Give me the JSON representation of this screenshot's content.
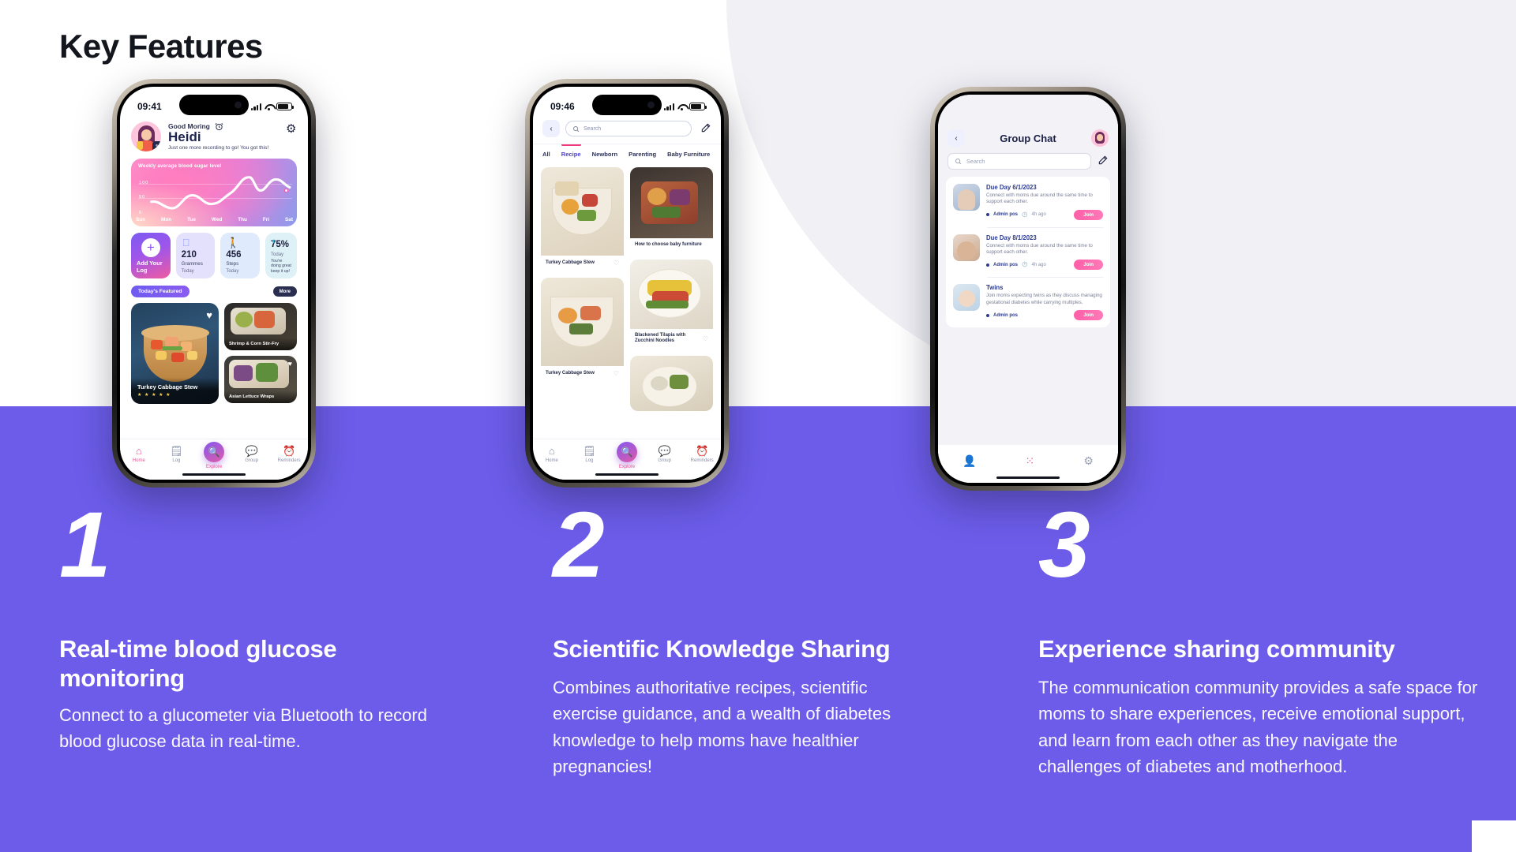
{
  "page": {
    "title": "Key Features",
    "background_white": "#ffffff",
    "background_purple": "#6c5ce9",
    "background_grey": "#f0f0f5"
  },
  "features": [
    {
      "number": "1",
      "title": "Real-time blood glucose monitoring",
      "body": "Connect to a glucometer via Bluetooth to record blood glucose data in real-time."
    },
    {
      "number": "2",
      "title": "Scientific Knowledge Sharing",
      "body": "Combines authoritative recipes, scientific exercise guidance, and a wealth of diabetes knowledge to help moms have healthier pregnancies!"
    },
    {
      "number": "3",
      "title": "Experience sharing community",
      "body": "The communication community provides a safe space for moms to share experiences, receive emotional support, and learn from each other as they navigate the challenges of diabetes and motherhood."
    }
  ],
  "phone1": {
    "status_time": "09:41",
    "greeting": "Good Moring",
    "user_name": "Heidi",
    "subtitle": "Just one more recording to go! You got this!",
    "alarm_icon": "alarm-clock-icon",
    "settings_icon": "gear-icon",
    "edit_icon": "pencil-icon",
    "chart_title": "Weekly average blood sugar level",
    "stats": [
      {
        "label": "Add Your Log",
        "icon": "plus-icon",
        "kind": "action"
      },
      {
        "value": "210",
        "unit": "Grammes",
        "when": "Today",
        "icon": "apple-icon",
        "kind": "metric"
      },
      {
        "value": "456",
        "unit": "Steps",
        "when": "Today",
        "icon": "walking-person-icon",
        "kind": "metric"
      },
      {
        "value": "75%",
        "unit": "Today",
        "note": "You're doing great keep it up!",
        "icon": "progress-ring-icon",
        "kind": "metric"
      }
    ],
    "featured_pill": "Today's Featured",
    "more_label": "More",
    "featured_cards": [
      {
        "title": "Turkey Cabbage Stew",
        "stars": "★ ★ ★ ★ ★"
      },
      {
        "title": "Shrimp & Corn Stir-Fry"
      },
      {
        "title": "Asian Lettuce Wraps"
      }
    ],
    "tabs": [
      {
        "label": "Home",
        "icon": "home-icon",
        "active": true
      },
      {
        "label": "Log",
        "icon": "log-icon",
        "active": false
      },
      {
        "label": "Explore",
        "icon": "search-icon",
        "active": true,
        "center": true
      },
      {
        "label": "Group",
        "icon": "chat-icon",
        "active": false
      },
      {
        "label": "Reminders",
        "icon": "alarm-icon",
        "active": false
      }
    ]
  },
  "phone2": {
    "status_time": "09:46",
    "back_icon": "chevron-left-icon",
    "search_placeholder": "Search",
    "search_icon": "search-icon",
    "compose_icon": "compose-icon",
    "tabs": [
      "All",
      "Recipe",
      "Newborn",
      "Parenting",
      "Baby Furniture"
    ],
    "active_tab": "Recipe",
    "cards": [
      {
        "title": "Turkey Cabbage Stew",
        "column": "left"
      },
      {
        "title": "How to choose baby furniture",
        "column": "right"
      },
      {
        "title": "Blackened Tilapia with Zucchini Noodles",
        "column": "right"
      },
      {
        "title": "Turkey Cabbage Stew",
        "column": "left"
      }
    ],
    "tabs_bottom": [
      {
        "label": "Home",
        "icon": "home-icon",
        "active": false
      },
      {
        "label": "Log",
        "icon": "log-icon",
        "active": false
      },
      {
        "label": "Explore",
        "icon": "search-icon",
        "active": true,
        "center": true
      },
      {
        "label": "Group",
        "icon": "chat-icon",
        "active": false
      },
      {
        "label": "Reminders",
        "icon": "alarm-icon",
        "active": false
      }
    ]
  },
  "phone3": {
    "back_icon": "chevron-left-icon",
    "title": "Group Chat",
    "avatar_icon": "user-avatar",
    "search_placeholder": "Search",
    "search_icon": "search-icon",
    "compose_icon": "compose-icon",
    "chats": [
      {
        "title": "Due Day 6/1/2023",
        "description": "Connect with moms due around the same time to support each other.",
        "admin": "Admin pos",
        "time": "4h ago",
        "join": "Join"
      },
      {
        "title": "Due Day 8/1/2023",
        "description": "Connect with moms due around the same time to support each other.",
        "admin": "Admin pos",
        "time": "4h ago",
        "join": "Join"
      },
      {
        "title": "Twins",
        "description": "Join moms expecting twins as they discuss managing gestational diabetes while carrying multiples.",
        "admin": "Admin pos",
        "time": "",
        "join": "Join"
      }
    ],
    "tabs": [
      {
        "icon": "person-icon",
        "active": false
      },
      {
        "icon": "group-icon",
        "active": true
      },
      {
        "icon": "gear-icon",
        "active": false
      }
    ]
  },
  "chart_data": {
    "type": "line",
    "title": "Weekly average blood sugar level",
    "categories": [
      "Sun",
      "Mon",
      "Tue",
      "Wed",
      "Thu",
      "Fri",
      "Sat"
    ],
    "values": [
      38,
      28,
      52,
      38,
      58,
      104,
      92
    ],
    "ytick_labels": [
      "100",
      "50",
      "0"
    ],
    "ylim": [
      0,
      120
    ],
    "ylabel": "",
    "xlabel": "",
    "grid": true,
    "highlight_point": "Sat",
    "legend": "none"
  }
}
